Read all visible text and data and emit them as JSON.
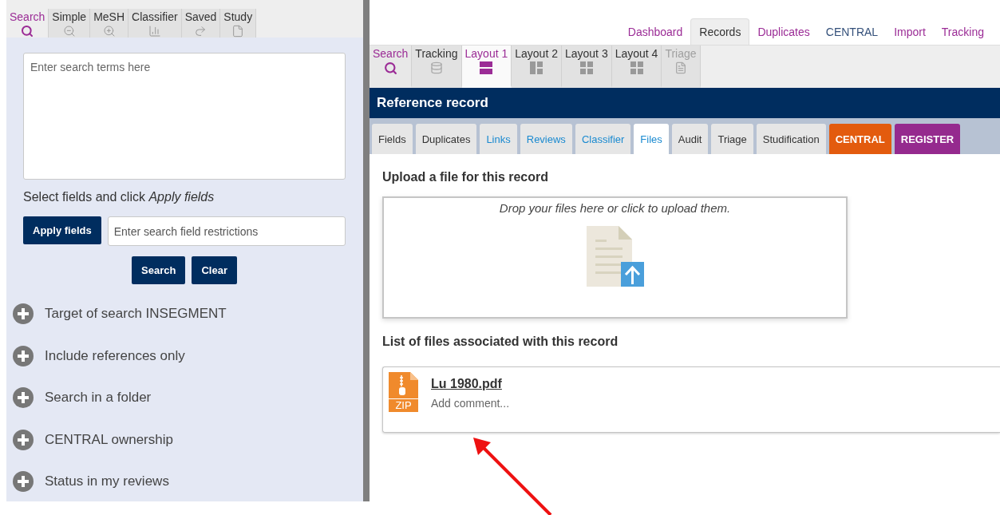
{
  "search_panel": {
    "tabs": [
      {
        "label": "Search",
        "selected": true
      },
      {
        "label": "Simple",
        "selected": false
      },
      {
        "label": "MeSH",
        "selected": false
      },
      {
        "label": "Classifier",
        "selected": false
      },
      {
        "label": "Saved",
        "selected": false
      },
      {
        "label": "Study",
        "selected": false
      }
    ],
    "query": {
      "placeholder": "Enter search terms here"
    },
    "fields_hint": "Select fields and click *Apply fields*",
    "apply_button": "Apply fields",
    "restrictions": {
      "placeholder": "Enter search field restrictions"
    },
    "buttons": [
      "Search",
      "Clear"
    ],
    "options": [
      {
        "label": "Target of search INSEGMENT",
        "expanded": false
      },
      {
        "label": "Include references only",
        "expanded": false
      },
      {
        "label": "Search in a folder",
        "expanded": false
      },
      {
        "label": "CENTRAL ownership",
        "expanded": false
      },
      {
        "label": "Status in my reviews",
        "expanded": false
      }
    ]
  },
  "top_nav": [
    {
      "label": "Dashboard",
      "selected": false,
      "color": "#9b2c96"
    },
    {
      "label": "Records",
      "selected": true,
      "color": "#333333"
    },
    {
      "label": "Duplicates",
      "selected": false,
      "color": "#9b2c96"
    },
    {
      "label": "CENTRAL",
      "selected": false,
      "color": "#34507a"
    },
    {
      "label": "Import",
      "selected": false,
      "color": "#9b2c96"
    },
    {
      "label": "Tracking",
      "selected": false,
      "color": "#9b2c96"
    }
  ],
  "layout_toolbar": [
    {
      "label": "Search",
      "selected": false,
      "disabled": false,
      "kind": "search"
    },
    {
      "label": "Tracking",
      "selected": false,
      "disabled": false,
      "kind": "tracking"
    },
    {
      "label": "Layout 1",
      "selected": true,
      "disabled": false,
      "kind": "rows"
    },
    {
      "label": "Layout 2",
      "selected": false,
      "disabled": false,
      "kind": "split"
    },
    {
      "label": "Layout 3",
      "selected": false,
      "disabled": false,
      "kind": "grid"
    },
    {
      "label": "Layout 4",
      "selected": false,
      "disabled": false,
      "kind": "grid"
    },
    {
      "label": "Triage",
      "selected": false,
      "disabled": true,
      "kind": "triage"
    }
  ],
  "record": {
    "title": "Reference record",
    "tabs": [
      {
        "label": "Fields",
        "selected": false,
        "kind": "plain"
      },
      {
        "label": "Duplicates",
        "selected": false,
        "kind": "plain"
      },
      {
        "label": "Links",
        "selected": false,
        "kind": "linked"
      },
      {
        "label": "Reviews",
        "selected": false,
        "kind": "linked"
      },
      {
        "label": "Classifier",
        "selected": false,
        "kind": "linked"
      },
      {
        "label": "Files",
        "selected": true,
        "kind": "linked"
      },
      {
        "label": "Audit",
        "selected": false,
        "kind": "plain"
      },
      {
        "label": "Triage",
        "selected": false,
        "kind": "plain"
      },
      {
        "label": "Studification",
        "selected": false,
        "kind": "plain"
      },
      {
        "label": "CENTRAL",
        "selected": false,
        "kind": "badge",
        "color": "#e35b0e"
      },
      {
        "label": "REGISTER",
        "selected": false,
        "kind": "badge",
        "color": "#952a8e"
      }
    ],
    "upload_heading": "Upload a file for this record",
    "drop_hint": "Drop your files here or click to upload them.",
    "files_heading": "List of files associated with this record",
    "files": [
      {
        "name": "Lu 1980.pdf",
        "type": "ZIP",
        "comment_placeholder": "Add comment..."
      }
    ]
  }
}
